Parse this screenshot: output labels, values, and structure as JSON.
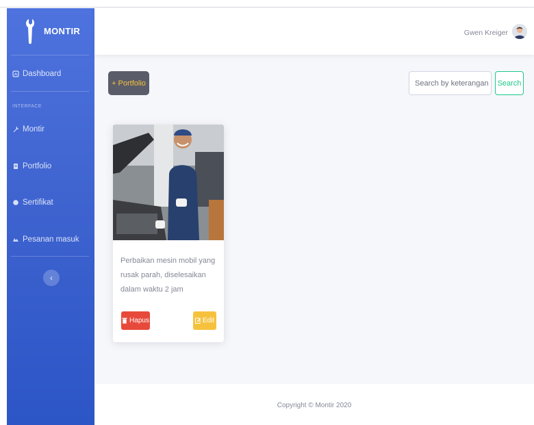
{
  "app": {
    "brand": "MONTIR",
    "accent": "#4e73df"
  },
  "sidebar": {
    "items": [
      {
        "label": "Dashboard",
        "icon": "tachometer-icon"
      },
      {
        "label": "Montir",
        "icon": "wrench-icon"
      },
      {
        "label": "Portfolio",
        "icon": "folder-icon"
      },
      {
        "label": "Sertifikat",
        "icon": "certificate-icon"
      },
      {
        "label": "Pesanan masuk",
        "icon": "inbox-icon"
      }
    ],
    "section_heading": "INTERFACE",
    "toggle_glyph": "‹"
  },
  "topbar": {
    "user_name": "Gwen Kreiger"
  },
  "toolbar": {
    "add_label": "+ Portfolio",
    "search_placeholder": "Search by keterangan",
    "search_label": "Search"
  },
  "portfolio": {
    "cards": [
      {
        "description": "Perbaikan mesin mobil yang rusak parah, diselesaikan dalam waktu 2 jam",
        "delete_label": "Hapus",
        "edit_label": "Edit"
      }
    ]
  },
  "footer": {
    "copyright": "Copyright © Montir 2020"
  },
  "colors": {
    "danger": "#e74a3b",
    "warning": "#f6c23e",
    "success": "#1cc88a",
    "dark": "#5a5c69"
  }
}
